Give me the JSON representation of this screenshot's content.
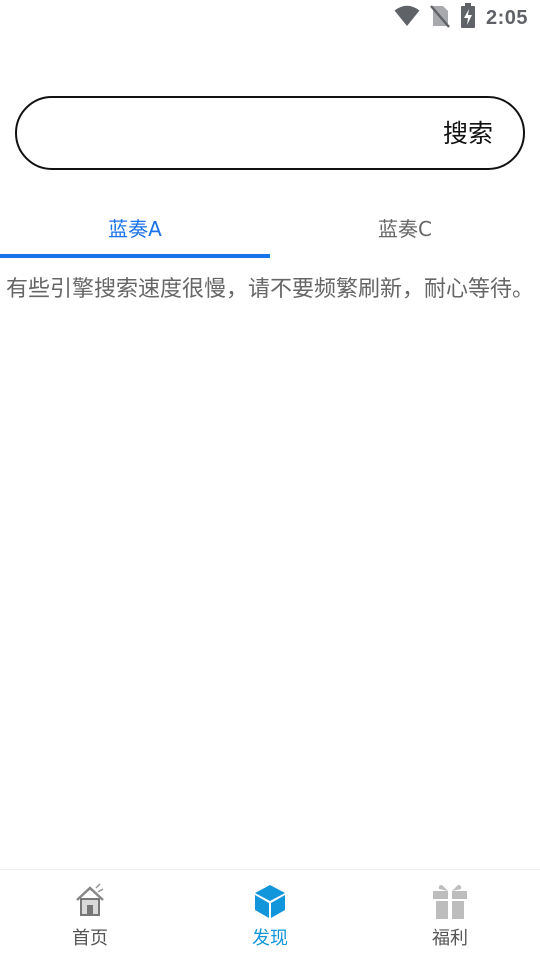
{
  "status_bar": {
    "time": "2:05",
    "icons": [
      "wifi-icon",
      "no-sim-icon",
      "battery-charging-icon"
    ]
  },
  "search": {
    "placeholder": "",
    "value": "",
    "button_label": "搜索"
  },
  "tabs": [
    {
      "label": "蓝奏A",
      "active": true
    },
    {
      "label": "蓝奏C",
      "active": false
    }
  ],
  "notice": "有些引擎搜索速度很慢，请不要频繁刷新，耐心等待。",
  "bottom_nav": {
    "items": [
      {
        "label": "首页",
        "icon": "home-icon",
        "active": false
      },
      {
        "label": "发现",
        "icon": "cube-icon",
        "active": true
      },
      {
        "label": "福利",
        "icon": "gift-icon",
        "active": false
      }
    ]
  },
  "colors": {
    "accent": "#1a73e8",
    "nav_active": "#1296db",
    "text_secondary": "#666666",
    "icon_gray": "#bdbdbd"
  }
}
